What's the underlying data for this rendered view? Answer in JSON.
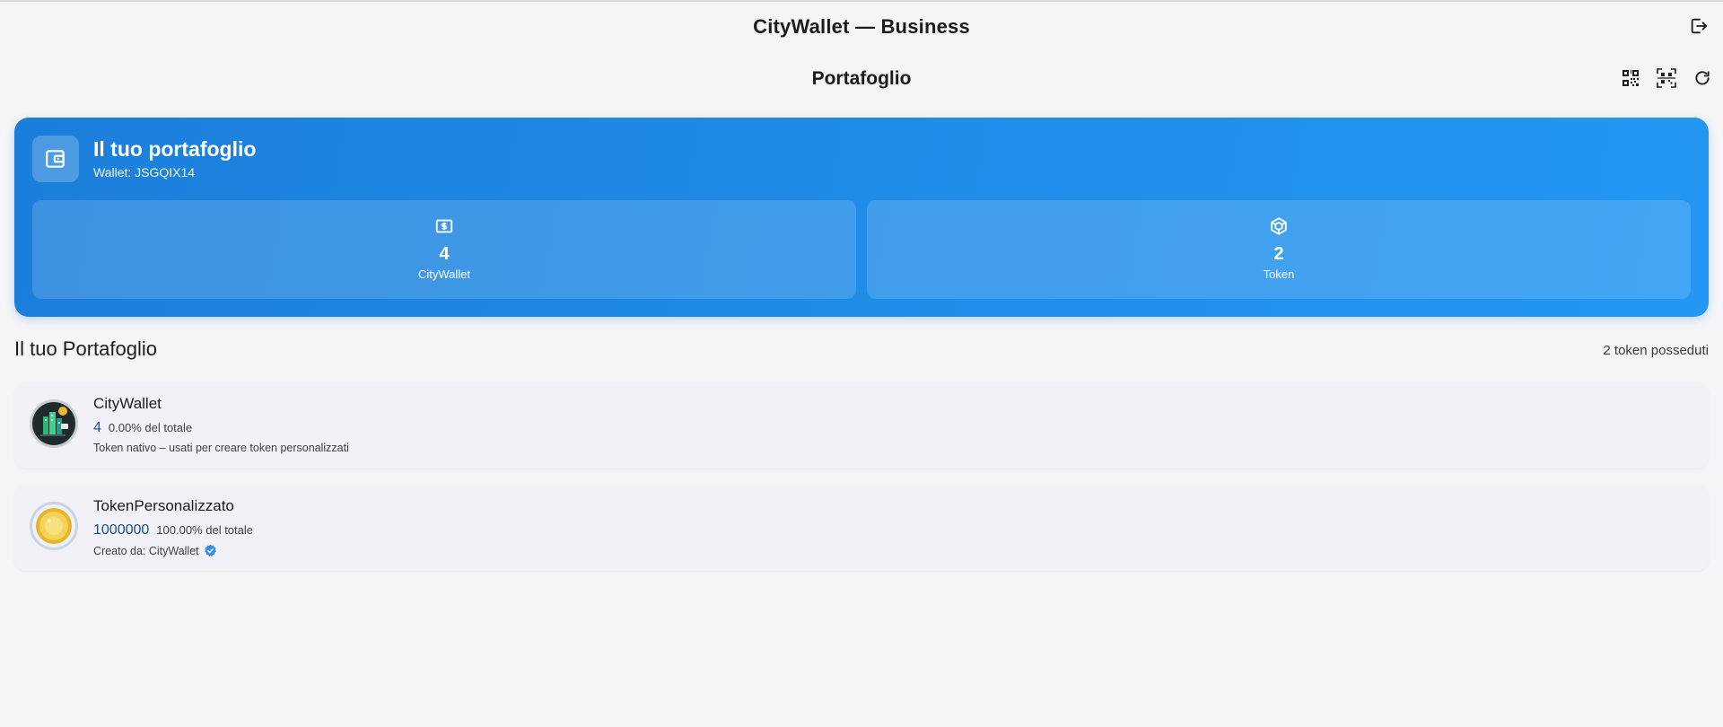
{
  "app": {
    "title": "CityWallet — Business"
  },
  "page": {
    "title": "Portafoglio"
  },
  "icons": {
    "logout": "logout-icon",
    "qr_show": "qr-code-icon",
    "qr_scan": "qr-scan-icon",
    "refresh": "refresh-icon"
  },
  "hero": {
    "title": "Il tuo portafoglio",
    "wallet_label": "Wallet: JSGQIX14",
    "stats": [
      {
        "value": "4",
        "label": "CityWallet",
        "icon": "money-icon"
      },
      {
        "value": "2",
        "label": "Token",
        "icon": "cube-icon"
      }
    ]
  },
  "portfolio": {
    "title": "Il tuo Portafoglio",
    "count_label": "2 token posseduti",
    "tokens": [
      {
        "name": "CityWallet",
        "amount": "4",
        "percent": "0.00% del totale",
        "description": "Token nativo – usati per creare token personalizzati",
        "avatar": "citywallet-logo"
      },
      {
        "name": "TokenPersonalizzato",
        "amount": "1000000",
        "percent": "100.00% del totale",
        "description": "Creato da: CityWallet",
        "verified": "verified-badge-icon",
        "avatar": "gold-coin-logo"
      }
    ]
  },
  "colors": {
    "accent": "#1f8ce8",
    "background": "#f5f5f8",
    "amount_text": "#1d4f8f",
    "verified": "#2d8df0"
  }
}
